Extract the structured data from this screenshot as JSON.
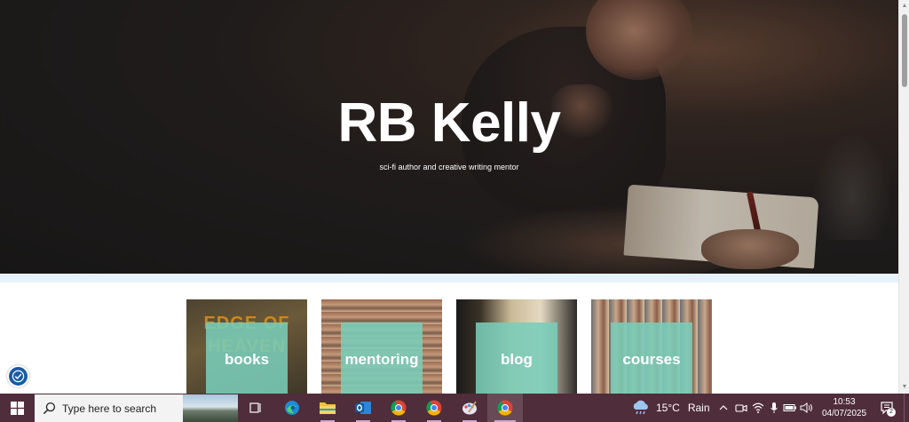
{
  "hero": {
    "title": "RB Kelly",
    "subtitle": "sci-fi author and creative writing mentor"
  },
  "cards": [
    {
      "label": "books",
      "cover_text": "EDGE OF HEAVEN"
    },
    {
      "label": "mentoring"
    },
    {
      "label": "blog"
    },
    {
      "label": "courses"
    }
  ],
  "taskbar": {
    "search_placeholder": "Type here to search",
    "weather": {
      "temp": "15°C",
      "condition": "Rain"
    },
    "clock": {
      "time": "10:53",
      "date": "04/07/2025"
    },
    "notification_count": "2",
    "accent_color": "#4f2d3a"
  },
  "colors": {
    "card_overlay": "#79cdb8",
    "strip": "#e6f3fb"
  }
}
